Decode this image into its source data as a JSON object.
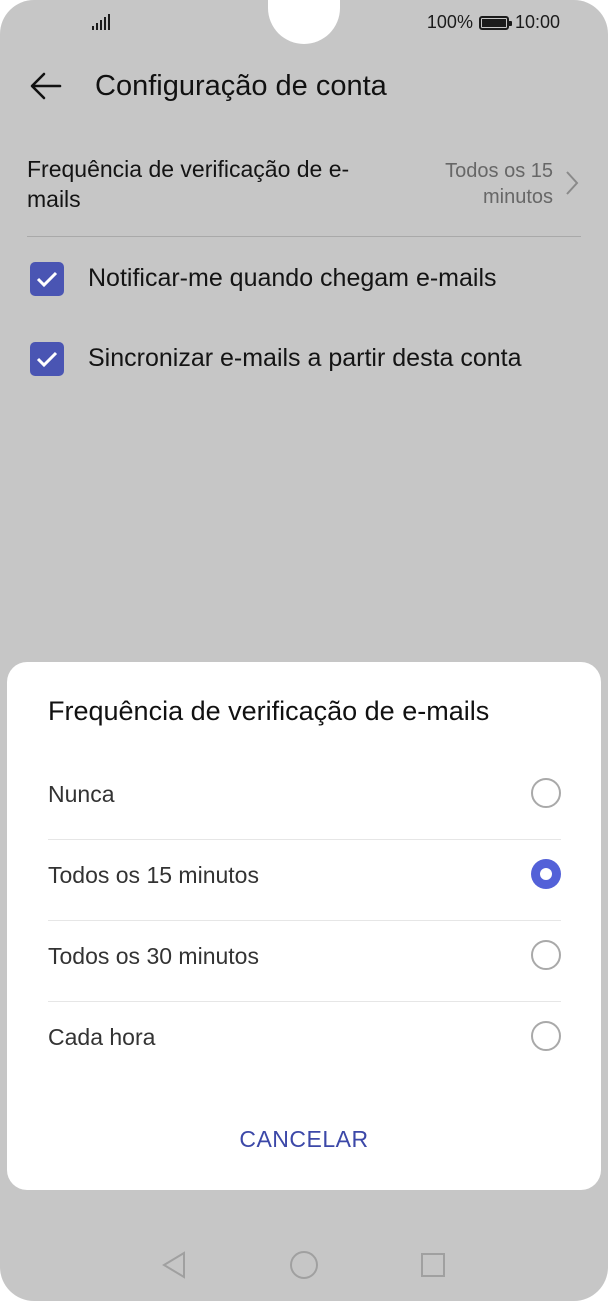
{
  "status_bar": {
    "battery_text": "100%",
    "time": "10:00",
    "signal_icon": "signal-icon",
    "battery_icon": "battery-icon"
  },
  "header": {
    "title": "Configuração de conta",
    "back_icon": "arrow-left-icon"
  },
  "settings": {
    "frequency_label": "Frequência de verificação de e-mails",
    "frequency_value": "Todos os 15 minutos",
    "checkboxes": [
      {
        "label": "Notificar-me quando chegam e-mails",
        "checked": true
      },
      {
        "label": "Sincronizar e-mails a partir desta conta",
        "checked": true
      }
    ]
  },
  "dialog": {
    "title": "Frequência de verificação de e-mails",
    "options": [
      {
        "label": "Nunca",
        "selected": false
      },
      {
        "label": "Todos os 15 minutos",
        "selected": true
      },
      {
        "label": "Todos os 30 minutos",
        "selected": false
      },
      {
        "label": "Cada hora",
        "selected": false
      }
    ],
    "cancel_label": "CANCELAR"
  },
  "nav": {
    "back_icon": "triangle-back-icon",
    "home_icon": "circle-home-icon",
    "recents_icon": "square-recents-icon"
  },
  "colors": {
    "accent": "#4a55b3",
    "radio_selected": "#5361d8",
    "scrim": "#c6c6c6"
  }
}
